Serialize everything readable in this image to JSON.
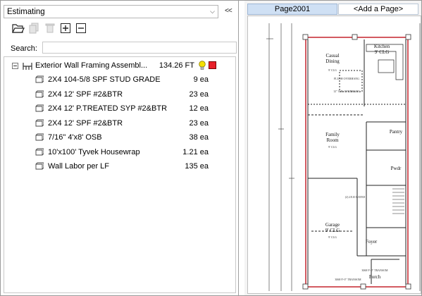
{
  "left_panel": {
    "mode_select": {
      "value": "Estimating",
      "arrow": "chevron-down-icon"
    },
    "collapse_label": "<<",
    "toolbar": {
      "open_icon": "folder-open-icon",
      "copy_icon": "copy-icon",
      "delete_icon": "trash-icon",
      "expand_icon": "plus-box-icon",
      "collapse_icon": "minus-box-icon"
    },
    "search": {
      "label": "Search:",
      "value": ""
    },
    "tree": {
      "assembly": {
        "name": "Exterior Wall Framing Assembl...",
        "quantity": "134.26 FT",
        "lightbulb_color": "#f5e000",
        "swatch_color": "#e8202a"
      },
      "items": [
        {
          "name": "2X4 104-5/8 SPF STUD GRADE",
          "quantity": "9 ea"
        },
        {
          "name": "2X4 12' SPF #2&BTR",
          "quantity": "23 ea"
        },
        {
          "name": "2X4 12' P.TREATED SYP #2&BTR",
          "quantity": "12 ea"
        },
        {
          "name": "2X4 12' SPF #2&BTR",
          "quantity": "23 ea"
        },
        {
          "name": "7/16\" 4'x8' OSB",
          "quantity": "38 ea"
        },
        {
          "name": "10'x100' Tyvek Housewrap",
          "quantity": "1.21 ea"
        },
        {
          "name": "Wall Labor per LF",
          "quantity": "135 ea"
        }
      ]
    }
  },
  "right_panel": {
    "tabs": [
      {
        "label": "Page2001",
        "active": true
      },
      {
        "label": "<Add a Page>",
        "active": false
      }
    ],
    "plan": {
      "rooms": [
        {
          "name": "Casual",
          "sub": "Dining"
        },
        {
          "name": "Kitchen",
          "sub": "9' CLG"
        },
        {
          "name": "Family",
          "sub": "Room"
        },
        {
          "name": "Garage",
          "sub": "9' CLG"
        },
        {
          "name": "Pantry",
          "sub": ""
        },
        {
          "name": "Pwdr",
          "sub": ""
        },
        {
          "name": "Foyer",
          "sub": ""
        },
        {
          "name": "Porch",
          "sub": ""
        }
      ],
      "notes": [
        "FLUSH OVERHANG",
        "12\" O.H. OVERHANG",
        "(2) 2X10 RATED",
        "3068 9'-0\" TRANSOM",
        "3068 9'-0\" TRANSOM",
        "9' CLG",
        "9' CLG",
        "9' CLG"
      ],
      "wall_color": "#c8323a"
    }
  }
}
